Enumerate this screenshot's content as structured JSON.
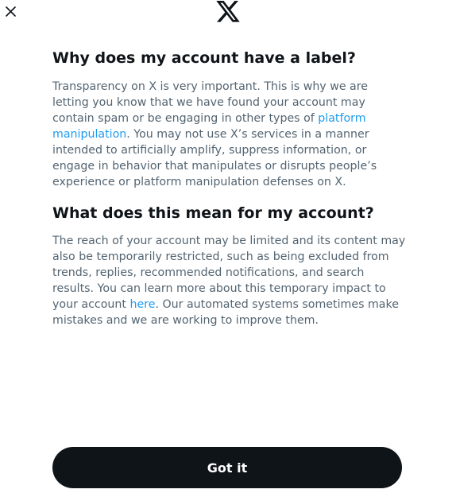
{
  "icons": {
    "close": "close-icon",
    "logo": "x-logo-icon"
  },
  "section1": {
    "heading": "Why does my account have a label?",
    "text_before_link": "Transparency on X is very important. This is why we are letting you know that we have found your account may contain spam or be engaging in other types of ",
    "link": "platform manipulation",
    "text_after_link": ". You may not use X’s services in a manner intended to artificially amplify, suppress information, or engage in behavior that manipulates or disrupts people’s experience or platform manipulation defenses on X."
  },
  "section2": {
    "heading": "What does this mean for my account?",
    "text_before_link": "The reach of your account may be limited and its content may also be temporarily restricted, such as being excluded from trends, replies, recommended notifications, and search results. You can learn more about this temporary impact to your account ",
    "link": "here",
    "text_after_link": ". Our automated systems sometimes make mistakes and we are working to improve them."
  },
  "button": {
    "label": "Got it"
  },
  "colors": {
    "text_primary": "#0f1419",
    "text_secondary": "#536471",
    "link": "#1d9bf0",
    "button_bg": "#0f1419",
    "button_text": "#ffffff",
    "background": "#ffffff"
  }
}
